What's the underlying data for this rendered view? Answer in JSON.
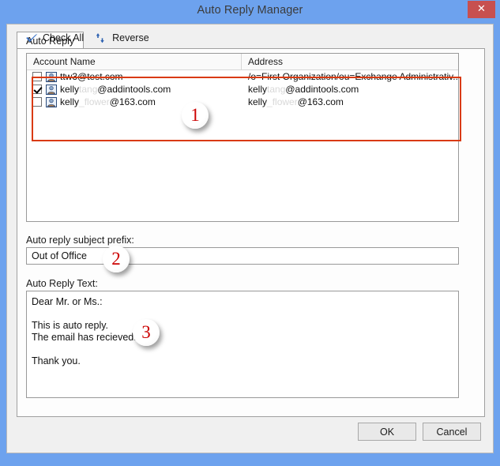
{
  "window": {
    "title": "Auto Reply Manager",
    "close_label": "✕",
    "frame_color": "#6da2ee",
    "close_color": "#c75050"
  },
  "tabs": [
    {
      "label": "Auto Reply",
      "active": true
    }
  ],
  "toolbar": {
    "check_all_label": "Check All",
    "check_all_icon": "check-icon",
    "reverse_label": "Reverse",
    "reverse_icon": "sort-updown-icon"
  },
  "account_list": {
    "columns": [
      "Account Name",
      "Address"
    ],
    "rows": [
      {
        "checked": false,
        "icon": "contact-icon",
        "name_visible": "ttw3@test.com",
        "name_redacted": "",
        "name_suffix": "",
        "address": "/o=First Organization/ou=Exchange Administrativ..."
      },
      {
        "checked": true,
        "icon": "contact-icon",
        "name_visible": "kelly",
        "name_redacted": "tang",
        "name_suffix": "@addintools.com",
        "address_visible": "kelly",
        "address_redacted": "tang",
        "address_suffix": "@addintools.com",
        "address": "kelly@addintools.com"
      },
      {
        "checked": false,
        "icon": "contact-icon",
        "name_visible": "kelly",
        "name_redacted": "_flower",
        "name_suffix": "@163.com",
        "address_visible": "kelly",
        "address_redacted": "_flower",
        "address_suffix": "@163.com",
        "address": "kelly_flower@163.com"
      }
    ]
  },
  "subject_prefix": {
    "label": "Auto reply subject prefix:",
    "value": "Out of Office",
    "placeholder": ""
  },
  "reply_body": {
    "label": "Auto Reply Text:",
    "value": "Dear Mr. or Ms.:\n\nThis is auto reply.\nThe email has recieved.\n\nThank you.",
    "placeholder": ""
  },
  "footer": {
    "ok_label": "OK",
    "cancel_label": "Cancel"
  },
  "annotations": {
    "highlight_color": "#d93a10",
    "badge_color": "#cc0000",
    "badges": [
      {
        "number": "1",
        "target": "account-list"
      },
      {
        "number": "2",
        "target": "subject-prefix-input"
      },
      {
        "number": "3",
        "target": "reply-body-textarea"
      }
    ]
  }
}
